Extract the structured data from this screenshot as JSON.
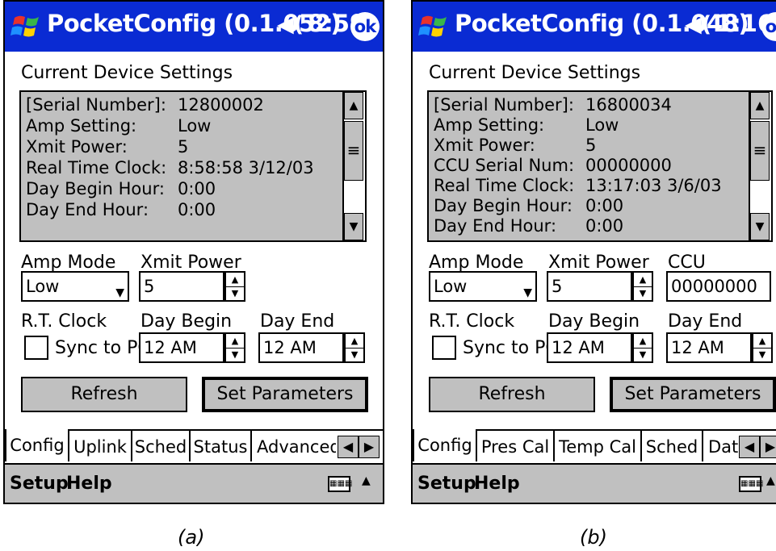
{
  "panel_a": {
    "title": "PocketConfig (0.1.052)",
    "speaker_icon": "speaker-icon",
    "time": "8:59",
    "ok_label": "ok",
    "settings_label": "Current Device Settings",
    "settings": [
      {
        "key": "[Serial Number]:",
        "value": "12800002"
      },
      {
        "key": "Amp Setting:",
        "value": "Low"
      },
      {
        "key": "Xmit Power:",
        "value": "5"
      },
      {
        "key": "Real Time Clock:",
        "value": "8:58:58  3/12/03"
      },
      {
        "key": "Day Begin Hour:",
        "value": "0:00"
      },
      {
        "key": "Day End Hour:",
        "value": "0:00"
      }
    ],
    "amp_mode_label": "Amp Mode",
    "amp_mode_value": "Low",
    "xmit_power_label": "Xmit Power",
    "xmit_power_value": "5",
    "rt_clock_label": "R.T. Clock",
    "sync_label": "Sync to PC",
    "day_begin_label": "Day Begin",
    "day_begin_value": "12 AM",
    "day_end_label": "Day End",
    "day_end_value": "12 AM",
    "refresh_label": "Refresh",
    "set_params_label": "Set Parameters",
    "tabs": [
      "Config",
      "Uplink",
      "Sched",
      "Status",
      "Advanced"
    ],
    "menu": [
      "Setup",
      "Help"
    ],
    "caption": "(a)"
  },
  "panel_b": {
    "title": "PocketConfig (0.1.048)",
    "speaker_icon": "speaker-icon",
    "time": "1:16",
    "ok_label": "ok",
    "settings_label": "Current Device Settings",
    "settings": [
      {
        "key": "[Serial Number]:",
        "value": "16800034"
      },
      {
        "key": "Amp Setting:",
        "value": "Low"
      },
      {
        "key": "Xmit Power:",
        "value": "5"
      },
      {
        "key": "CCU Serial Num:",
        "value": "00000000"
      },
      {
        "key": "Real Time Clock:",
        "value": "13:17:03  3/6/03"
      },
      {
        "key": "Day Begin Hour:",
        "value": "0:00"
      },
      {
        "key": "Day End Hour:",
        "value": "0:00"
      }
    ],
    "amp_mode_label": "Amp Mode",
    "amp_mode_value": "Low",
    "xmit_power_label": "Xmit Power",
    "xmit_power_value": "5",
    "ccu_label": "CCU",
    "ccu_value": "00000000",
    "rt_clock_label": "R.T. Clock",
    "sync_label": "Sync to PC",
    "day_begin_label": "Day Begin",
    "day_begin_value": "12 AM",
    "day_end_label": "Day End",
    "day_end_value": "12 AM",
    "refresh_label": "Refresh",
    "set_params_label": "Set Parameters",
    "tabs": [
      "Config",
      "Pres Cal",
      "Temp Cal",
      "Sched",
      "Data"
    ],
    "menu": [
      "Setup",
      "Help"
    ],
    "caption": "(b)"
  },
  "colors": {
    "titlebar": "#0a2bd3",
    "panel_gray": "#c0c0c0"
  }
}
